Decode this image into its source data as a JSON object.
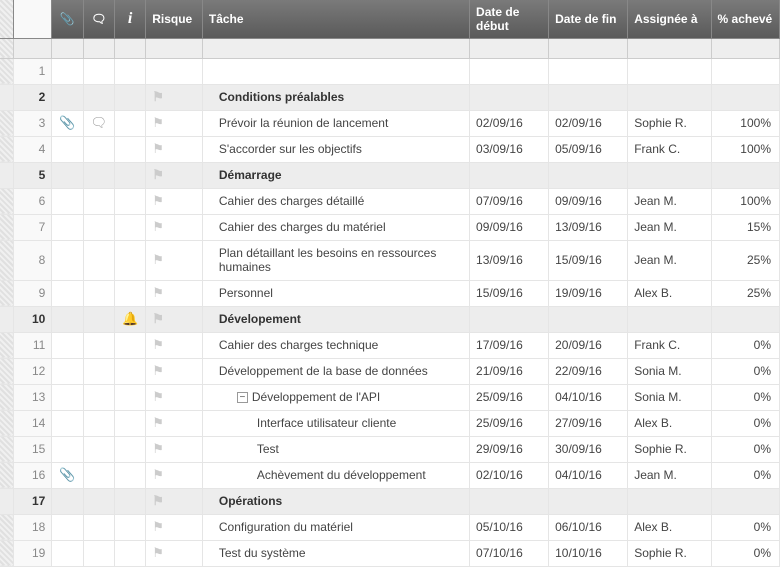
{
  "headers": {
    "attach": "📎",
    "comment": "💬",
    "info": "i",
    "risk": "Risque",
    "task": "Tâche",
    "start": "Date de début",
    "end": "Date de fin",
    "assignee": "Assignée à",
    "pct": "% achevé"
  },
  "rows": [
    {
      "n": 1,
      "type": "data",
      "indent": 0,
      "flag": false,
      "task": "",
      "start": "",
      "end": "",
      "assignee": "",
      "pct": ""
    },
    {
      "n": 2,
      "type": "section",
      "indent": 1,
      "flag": true,
      "task": "Conditions préalables",
      "start": "",
      "end": "",
      "assignee": "",
      "pct": ""
    },
    {
      "n": 3,
      "type": "data",
      "indent": 1,
      "flag": true,
      "attach": true,
      "comment": true,
      "task": "Prévoir la réunion de lancement",
      "start": "02/09/16",
      "end": "02/09/16",
      "assignee": "Sophie R.",
      "pct": "100%"
    },
    {
      "n": 4,
      "type": "data",
      "indent": 1,
      "flag": true,
      "task": "S'accorder sur les objectifs",
      "start": "03/09/16",
      "end": "05/09/16",
      "assignee": "Frank C.",
      "pct": "100%"
    },
    {
      "n": 5,
      "type": "section",
      "indent": 1,
      "flag": true,
      "task": "Démarrage",
      "start": "",
      "end": "",
      "assignee": "",
      "pct": ""
    },
    {
      "n": 6,
      "type": "data",
      "indent": 1,
      "flag": true,
      "task": "Cahier des charges détaillé",
      "start": "07/09/16",
      "end": "09/09/16",
      "assignee": "Jean M.",
      "pct": "100%"
    },
    {
      "n": 7,
      "type": "data",
      "indent": 1,
      "flag": true,
      "task": "Cahier des charges du matériel",
      "start": "09/09/16",
      "end": "13/09/16",
      "assignee": "Jean M.",
      "pct": "15%"
    },
    {
      "n": 8,
      "type": "data",
      "indent": 1,
      "flag": true,
      "tall": true,
      "task": "Plan détaillant les besoins en ressources humaines",
      "start": "13/09/16",
      "end": "15/09/16",
      "assignee": "Jean M.",
      "pct": "25%"
    },
    {
      "n": 9,
      "type": "data",
      "indent": 1,
      "flag": true,
      "task": "Personnel",
      "start": "15/09/16",
      "end": "19/09/16",
      "assignee": "Alex B.",
      "pct": "25%"
    },
    {
      "n": 10,
      "type": "section",
      "indent": 1,
      "flag": true,
      "bell": true,
      "task": "Dévelopement",
      "start": "",
      "end": "",
      "assignee": "",
      "pct": ""
    },
    {
      "n": 11,
      "type": "data",
      "indent": 1,
      "flag": true,
      "task": "Cahier des charges technique",
      "start": "17/09/16",
      "end": "20/09/16",
      "assignee": "Frank C.",
      "pct": "0%"
    },
    {
      "n": 12,
      "type": "data",
      "indent": 1,
      "flag": true,
      "task": "Développement de la base de données",
      "start": "21/09/16",
      "end": "22/09/16",
      "assignee": "Sonia M.",
      "pct": "0%"
    },
    {
      "n": 13,
      "type": "data",
      "indent": 2,
      "flag": true,
      "collapse": true,
      "task": "Développement de l'API",
      "start": "25/09/16",
      "end": "04/10/16",
      "assignee": "Sonia M.",
      "pct": "0%"
    },
    {
      "n": 14,
      "type": "data",
      "indent": 3,
      "flag": true,
      "task": "Interface utilisateur cliente",
      "start": "25/09/16",
      "end": "27/09/16",
      "assignee": "Alex B.",
      "pct": "0%"
    },
    {
      "n": 15,
      "type": "data",
      "indent": 3,
      "flag": true,
      "task": "Test",
      "start": "29/09/16",
      "end": "30/09/16",
      "assignee": "Sophie R.",
      "pct": "0%"
    },
    {
      "n": 16,
      "type": "data",
      "indent": 3,
      "flag": true,
      "attach": true,
      "task": "Achèvement du développement",
      "start": "02/10/16",
      "end": "04/10/16",
      "assignee": "Jean M.",
      "pct": "0%"
    },
    {
      "n": 17,
      "type": "section",
      "indent": 1,
      "flag": true,
      "task": "Opérations",
      "start": "",
      "end": "",
      "assignee": "",
      "pct": ""
    },
    {
      "n": 18,
      "type": "data",
      "indent": 1,
      "flag": true,
      "task": "Configuration du matériel",
      "start": "05/10/16",
      "end": "06/10/16",
      "assignee": "Alex B.",
      "pct": "0%"
    },
    {
      "n": 19,
      "type": "data",
      "indent": 1,
      "flag": true,
      "task": "Test du système",
      "start": "07/10/16",
      "end": "10/10/16",
      "assignee": "Sophie R.",
      "pct": "0%"
    }
  ]
}
